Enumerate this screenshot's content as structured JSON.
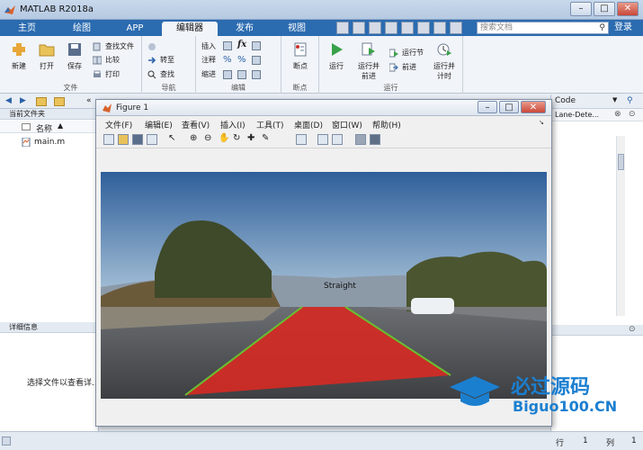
{
  "app": {
    "title": "MATLAB R2018a",
    "search_placeholder": "搜索文档",
    "login": "登录"
  },
  "tabs": [
    "主页",
    "绘图",
    "APP",
    "编辑器",
    "发布",
    "视图"
  ],
  "ribbon": {
    "file_group": {
      "label": "文件",
      "new": "新建",
      "open": "打开",
      "save": "保存",
      "find_files": "查找文件",
      "compare": "比较",
      "print": "打印"
    },
    "nav_group": {
      "label": "导航",
      "goto": "转至",
      "find": "查找"
    },
    "edit_group": {
      "label": "编辑",
      "insert": "插入",
      "comment": "注释",
      "indent": "缩进",
      "fx": "fx"
    },
    "breakpoints_group": {
      "label": "断点",
      "breakpoints": "断点"
    },
    "run_group": {
      "label": "运行",
      "run": "运行",
      "run_advance": "运行并\n前进",
      "run_section": "运行节",
      "advance": "前进",
      "run_time": "运行并\n计时"
    }
  },
  "address_text": "«",
  "right_header": "Code",
  "right_path": "Lane-Dete...",
  "left_panel": {
    "current_folder": "当前文件夹",
    "name_col": "名称",
    "file": "main.m",
    "details_header": "详细信息",
    "details_msg": "选择文件以查看详..."
  },
  "status": {
    "row_label": "行",
    "row_value": "1",
    "col_label": "列",
    "col_value": "1"
  },
  "figure": {
    "title": "Figure 1",
    "menus": [
      "文件(F)",
      "编辑(E)",
      "查看(V)",
      "插入(I)",
      "工具(T)",
      "桌面(D)",
      "窗口(W)",
      "帮助(H)"
    ],
    "annotation": "Straight"
  },
  "watermark": {
    "brand": "必过源码",
    "url": "Biguo100.CN"
  },
  "colors": {
    "accent": "#2b6bb0",
    "lane_fill": "#d42a24",
    "lane_line": "#6abf2f"
  }
}
